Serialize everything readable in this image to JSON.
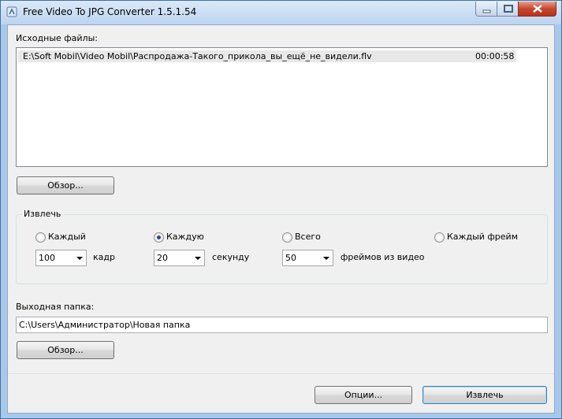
{
  "window": {
    "title": "Free Video To JPG Converter 1.5.1.54"
  },
  "source": {
    "label": "Исходные файлы:",
    "files": [
      {
        "path": "E:\\Soft Mobil\\Video Mobil\\Распродажа-Такого_прикола_вы_ещё_не_видели.flv",
        "duration": "00:00:58"
      }
    ],
    "browse_label": "Обзор..."
  },
  "extract": {
    "label": "Извлечь",
    "options": [
      {
        "label": "Каждый",
        "checked": false,
        "value": "100",
        "unit": "кадр"
      },
      {
        "label": "Каждую",
        "checked": true,
        "value": "20",
        "unit": "секунду"
      },
      {
        "label": "Всего",
        "checked": false,
        "value": "50",
        "unit": "фреймов из видео"
      },
      {
        "label": "Каждый фрейм",
        "checked": false
      }
    ]
  },
  "output": {
    "label": "Выходная папка:",
    "path": "C:\\Users\\Администратор\\Новая папка",
    "browse_label": "Обзор..."
  },
  "footer": {
    "options_label": "Опции...",
    "extract_label": "Извлечь"
  }
}
